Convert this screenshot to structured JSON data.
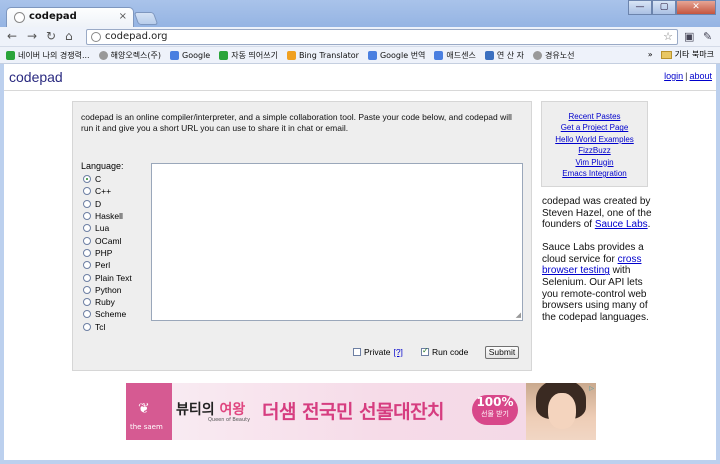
{
  "browser": {
    "tab_title": "codepad",
    "tab_close": "×",
    "url": "codepad.org",
    "window_buttons": {
      "minimize": "—",
      "maximize": "▢",
      "close": "✕"
    }
  },
  "bookmarks": [
    {
      "label": "네이버 나의 경쟁력...",
      "color": "#2aa43a"
    },
    {
      "label": "해양오렉스(주)",
      "color": "#999999"
    },
    {
      "label": "Google",
      "color": "#4a7fe0"
    },
    {
      "label": "자동 띄어쓰기",
      "color": "#2aa43a"
    },
    {
      "label": "Bing Translator",
      "color": "#f0a020"
    },
    {
      "label": "Google 번역",
      "color": "#4a7fe0"
    },
    {
      "label": "애드센스",
      "color": "#4a7fe0"
    },
    {
      "label": "연 산 자",
      "color": "#3a6fc0"
    },
    {
      "label": "경유노선",
      "color": "#999999"
    }
  ],
  "bookmarks_more": "»",
  "bookmarks_other": "기타 북마크",
  "site": {
    "logo": "codepad",
    "login": "login",
    "separator": "|",
    "about": "about"
  },
  "form": {
    "intro": "codepad is an online compiler/interpreter, and a simple collaboration tool. Paste your code below, and codepad will run it and give you a short URL you can use to share it in chat or email.",
    "language_label": "Language:",
    "languages": [
      "C",
      "C++",
      "D",
      "Haskell",
      "Lua",
      "OCaml",
      "PHP",
      "Perl",
      "Plain Text",
      "Python",
      "Ruby",
      "Scheme",
      "Tcl"
    ],
    "selected_language": "C",
    "private_label": "Private",
    "private_help": "[?]",
    "run_label": "Run code",
    "submit_label": "Submit"
  },
  "sidebar_links": [
    "Recent Pastes",
    "Get a Project Page",
    "Hello World Examples",
    "FizzBuzz",
    "Vim Plugin",
    "Emacs Integration"
  ],
  "about_text": {
    "p1_before": "codepad was created by Steven Hazel, one of the founders of ",
    "p1_link": "Sauce Labs",
    "p1_after": ".",
    "p2_before": "Sauce Labs provides a cloud service for ",
    "p2_link": "cross browser testing",
    "p2_after": " with Selenium. Our API lets you remote-control web browsers using many of the codepad languages."
  },
  "ad": {
    "brand": "the saem",
    "headline_a": "뷰티의 ",
    "headline_b": "여왕",
    "subline": "Queen of Beauty",
    "big": "더샘 전국민 선물대잔치",
    "pct": "100%",
    "pct_sub": "선물 받기",
    "info": "▷"
  }
}
